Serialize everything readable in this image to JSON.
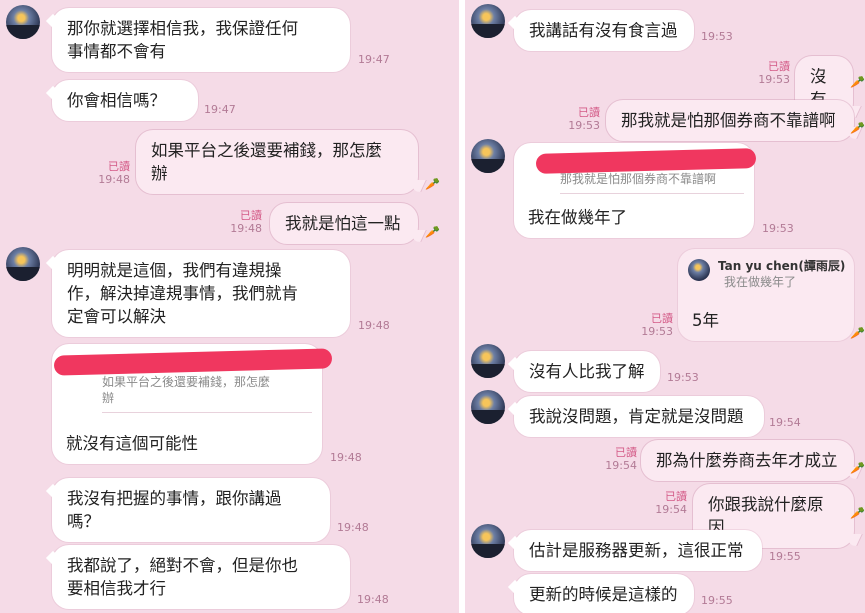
{
  "colors": {
    "background": "#f5dbe7",
    "bubble_them": "#ffffff",
    "bubble_me": "#fbe9f1",
    "read_label": "#d45a87",
    "time": "#b27a95",
    "redaction": "#f0375f"
  },
  "left": {
    "m1": {
      "text": "那你就選擇相信我，我保證任何\n事情都不會有",
      "time": "19:47"
    },
    "m2": {
      "text": "你會相信嗎？",
      "time": "19:47"
    },
    "m3": {
      "text": "如果平台之後還要補錢，那怎麼\n辦",
      "read": "已讀",
      "time": "19:48"
    },
    "m4": {
      "text": "我就是怕這一點",
      "read": "已讀",
      "time": "19:48"
    },
    "m5": {
      "text": "明明就是這個，我們有違規操\n作，解決掉違規事情，我們就肯\n定會可以解決",
      "time": "19:48"
    },
    "m6": {
      "quote": "如果平台之後還要補錢，那怎麼\n辦",
      "text": "就沒有這個可能性",
      "time": "19:48"
    },
    "m7": {
      "text": "我沒有把握的事情，跟你講過\n嗎？",
      "time": "19:48"
    },
    "m8": {
      "text": "我都說了，絕對不會，但是你也\n要相信我才行",
      "time": "19:48"
    }
  },
  "right": {
    "m1": {
      "text": "我講話有沒有食言過",
      "time": "19:53"
    },
    "m2": {
      "text": "沒有",
      "read": "已讀",
      "time": "19:53"
    },
    "m3": {
      "text": "那我就是怕那個券商不靠譜啊",
      "read": "已讀",
      "time": "19:53"
    },
    "m4": {
      "quote": "那我就是怕那個券商不靠譜啊",
      "text": "我在做幾年了",
      "time": "19:53"
    },
    "m5": {
      "quote_name": "Tan yu chen(譚雨辰)",
      "quote": "我在做幾年了",
      "text": "5年",
      "read": "已讀",
      "time": "19:53"
    },
    "m6": {
      "text": "沒有人比我了解",
      "time": "19:53"
    },
    "m7": {
      "text": "我說沒問題，肯定就是沒問題",
      "time": "19:54"
    },
    "m8": {
      "text": "那為什麼券商去年才成立",
      "read": "已讀",
      "time": "19:54"
    },
    "m9": {
      "text": "你跟我說什麼原因",
      "read": "已讀",
      "time": "19:54"
    },
    "m10": {
      "text": "估計是服務器更新，這很正常",
      "time": "19:55"
    },
    "m11": {
      "text": "更新的時候是這樣的",
      "time": "19:55"
    }
  },
  "icons": {
    "read_marker": "carrot-icon"
  }
}
